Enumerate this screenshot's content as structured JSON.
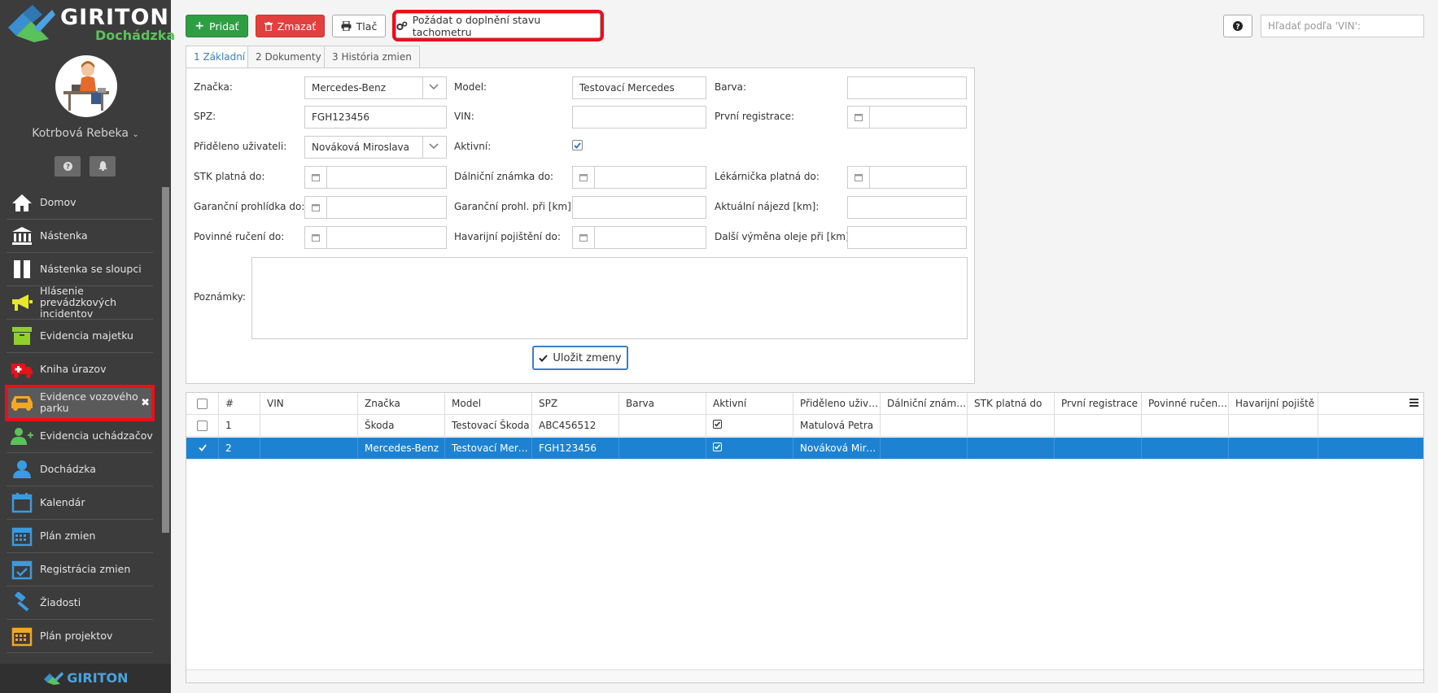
{
  "sidebar": {
    "brand": "GIRITON",
    "brand_sub": "Dochádzka",
    "user_name": "Kotrbová Rebeka",
    "help_btn": "?",
    "bell_btn": "notifications",
    "items": [
      {
        "label": "Domov",
        "icon": "home-icon"
      },
      {
        "label": "Nástenka",
        "icon": "bank-icon"
      },
      {
        "label": "Nástenka se sloupci",
        "icon": "columns-icon"
      },
      {
        "label": "Hlásenie prevádzkových incidentov",
        "icon": "megaphone-icon"
      },
      {
        "label": "Evidencia majetku",
        "icon": "archive-box-icon"
      },
      {
        "label": "Kniha úrazov",
        "icon": "ambulance-icon"
      },
      {
        "label": "Evidence vozového parku",
        "icon": "car-icon",
        "active": true
      },
      {
        "label": "Evidencia uchádzačov",
        "icon": "user-plus-icon"
      },
      {
        "label": "Dochádzka",
        "icon": "user-icon"
      },
      {
        "label": "Kalendár",
        "icon": "calendar-icon"
      },
      {
        "label": "Plán zmien",
        "icon": "calendar-grid-icon"
      },
      {
        "label": "Registrácia zmien",
        "icon": "calendar-check-icon"
      },
      {
        "label": "Žiadosti",
        "icon": "gavel-icon"
      },
      {
        "label": "Plán projektov",
        "icon": "calendar-grid-icon"
      }
    ],
    "footer_brand": "GIRITON",
    "colors": {
      "bg": "#3c3c3c",
      "accent": "#5bc25b",
      "highlight": "#e8101a"
    }
  },
  "toolbar": {
    "add": "Pridať",
    "delete": "Zmazať",
    "print": "Tlač",
    "request": "Požádat o doplnění stavu tachometru",
    "help": "?",
    "search_placeholder": "Hľadať podľa 'VIN':"
  },
  "tabs": [
    "1 Základní",
    "2 Dokumenty",
    "3 História zmien"
  ],
  "form": {
    "brand_label": "Značka:",
    "brand_value": "Mercedes-Benz",
    "model_label": "Model:",
    "model_value": "Testovací Mercedes",
    "color_label": "Barva:",
    "color_value": "",
    "spz_label": "SPZ:",
    "spz_value": "FGH123456",
    "vin_label": "VIN:",
    "vin_value": "",
    "first_reg_label": "První registrace:",
    "assigned_label": "Přiděleno uživateli:",
    "assigned_value": "Nováková Miroslava",
    "active_label": "Aktivní:",
    "active_value": true,
    "stk_label": "STK platná do:",
    "highway_label": "Dálniční známka do:",
    "firstaid_label": "Lékárnička platná do:",
    "warranty_label": "Garanční prohlídka do:",
    "warranty_km_label": "Garanční prohl. při [km]:",
    "mileage_label": "Aktuální nájezd [km]:",
    "insurance_label": "Povinné ručení do:",
    "accident_ins_label": "Havarijní pojištění do:",
    "oil_label": "Další výměna oleje při [km]:",
    "notes_label": "Poznámky:",
    "save": "Uložit zmeny"
  },
  "grid": {
    "columns": [
      "#",
      "VIN",
      "Značka",
      "Model",
      "SPZ",
      "Barva",
      "Aktivní",
      "Přiděleno uživateli",
      "Dálniční známka do",
      "STK platná do",
      "První registrace",
      "Povinné ručení do",
      "Havarijní pojiště"
    ],
    "rows": [
      {
        "num": "1",
        "vin": "",
        "brand": "Škoda",
        "model": "Testovací Škoda",
        "spz": "ABC456512",
        "color": "",
        "active": true,
        "assigned": "Matulová Petra",
        "highway": "",
        "stk": "",
        "first_reg": "",
        "insurance": "",
        "accident": "",
        "selected": false
      },
      {
        "num": "2",
        "vin": "",
        "brand": "Mercedes-Benz",
        "model": "Testovací Mercedes",
        "spz": "FGH123456",
        "color": "",
        "active": true,
        "assigned": "Nováková Miroslava",
        "highway": "",
        "stk": "",
        "first_reg": "",
        "insurance": "",
        "accident": "",
        "selected": true
      }
    ]
  }
}
